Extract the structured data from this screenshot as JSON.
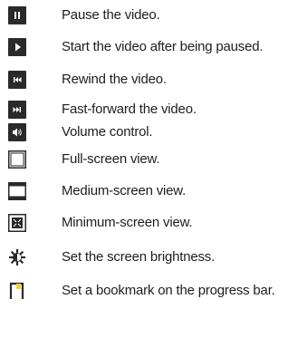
{
  "controls": [
    {
      "icon": "pause-icon",
      "label": "Pause the video."
    },
    {
      "icon": "play-icon",
      "label": "Start the video after being paused."
    },
    {
      "icon": "rewind-icon",
      "label": "Rewind the video."
    },
    {
      "icon": "fast-forward-icon",
      "label": "Fast-forward the video."
    },
    {
      "icon": "volume-icon",
      "label": "Volume control."
    },
    {
      "icon": "full-screen-icon",
      "label": "Full-screen view."
    },
    {
      "icon": "medium-screen-icon",
      "label": "Medium-screen view."
    },
    {
      "icon": "minimum-screen-icon",
      "label": "Minimum-screen view."
    },
    {
      "icon": "brightness-icon",
      "label": "Set the screen brightness."
    },
    {
      "icon": "bookmark-icon",
      "label": "Set a bookmark on the progress bar."
    }
  ],
  "colors": {
    "icon_dark": "#2a2a2a",
    "bookmark_accent": "#f2d230"
  }
}
